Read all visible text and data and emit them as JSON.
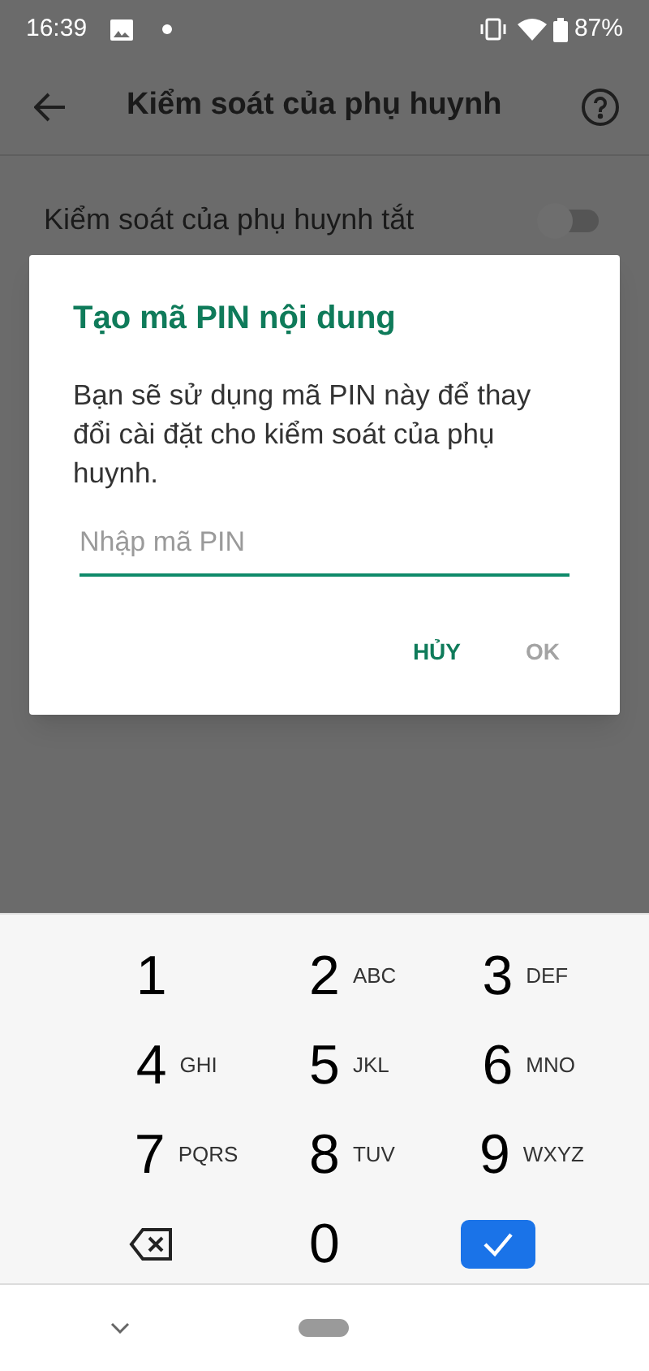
{
  "status_bar": {
    "time": "16:39",
    "battery": "87%"
  },
  "app_bar": {
    "title": "Kiểm soát của phụ huynh"
  },
  "setting": {
    "label": "Kiểm soát của phụ huynh tắt",
    "on": false
  },
  "dialog": {
    "title": "Tạo mã PIN nội dung",
    "message": "Bạn sẽ sử dụng mã PIN này để thay đổi cài đặt cho kiểm soát của phụ huynh.",
    "field": {
      "placeholder": "Nhập mã PIN"
    },
    "buttons": [
      {
        "label": "HỦY",
        "disabled": false
      },
      {
        "label": "OK",
        "disabled": true
      }
    ]
  },
  "keypad": [
    {
      "kind": "digit",
      "digit": "1"
    },
    {
      "kind": "digit",
      "digit": "2",
      "letters": "ABC"
    },
    {
      "kind": "digit",
      "digit": "3",
      "letters": "DEF"
    },
    {
      "kind": "digit",
      "digit": "4",
      "letters": "GHI"
    },
    {
      "kind": "digit",
      "digit": "5",
      "letters": "JKL"
    },
    {
      "kind": "digit",
      "digit": "6",
      "letters": "MNO"
    },
    {
      "kind": "digit",
      "digit": "7",
      "letters": "PQRS"
    },
    {
      "kind": "digit",
      "digit": "8",
      "letters": "TUV"
    },
    {
      "kind": "digit",
      "digit": "9",
      "letters": "WXYZ"
    },
    {
      "kind": "backspace"
    },
    {
      "kind": "digit",
      "digit": "0"
    },
    {
      "kind": "done"
    }
  ]
}
